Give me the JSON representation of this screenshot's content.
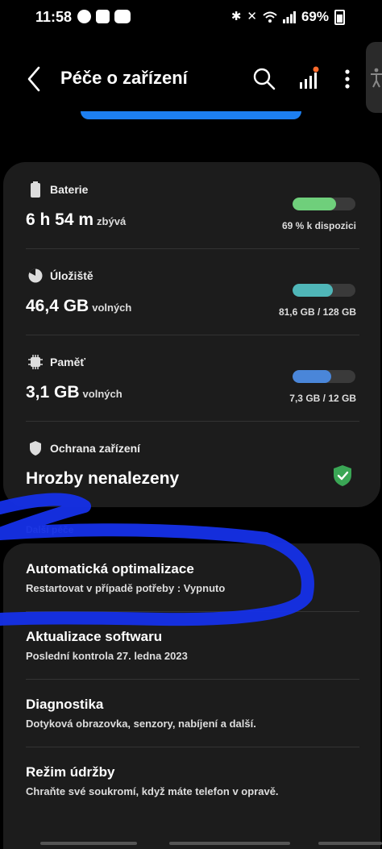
{
  "status_bar": {
    "time": "11:58",
    "battery_percent": "69%",
    "icons": [
      "messenger-icon",
      "notification-icon",
      "youtube-icon",
      "bluetooth-icon",
      "mute-icon",
      "wifi-icon",
      "signal-icon",
      "battery-icon"
    ]
  },
  "header": {
    "title": "Péče o zařízení"
  },
  "cards": {
    "battery": {
      "label": "Baterie",
      "value": "6 h 54 m",
      "unit": "zbývá",
      "detail": "69 % k dispozici",
      "level": 0.69,
      "color": "#6fcf7b"
    },
    "storage": {
      "label": "Úložiště",
      "value": "46,4 GB",
      "unit": "volných",
      "detail": "81,6 GB / 128 GB",
      "level": 0.64,
      "color": "#4fb6b8"
    },
    "memory": {
      "label": "Paměť",
      "value": "3,1 GB",
      "unit": "volných",
      "detail": "7,3 GB / 12 GB",
      "level": 0.61,
      "color": "#4a86d9"
    },
    "protection": {
      "label": "Ochrana zařízení",
      "value": "Hrozby nenalezeny",
      "color": "#3aa655"
    }
  },
  "more_care": {
    "section_title": "Další péče",
    "items": [
      {
        "title": "Automatická optimalizace",
        "subtitle": "Restartovat v případě potřeby : Vypnuto"
      },
      {
        "title": "Aktualizace softwaru",
        "subtitle": "Poslední kontrola 27. ledna 2023"
      },
      {
        "title": "Diagnostika",
        "subtitle": "Dotyková obrazovka, senzory, nabíjení a další."
      },
      {
        "title": "Režim údržby",
        "subtitle": "Chraňte své soukromí, když máte telefon v opravě."
      }
    ]
  },
  "colors": {
    "accent": "#1d7ff0",
    "scribble": "#1530e8",
    "card_bg": "#1c1c1c",
    "notification_dot": "#ff6b2c"
  }
}
